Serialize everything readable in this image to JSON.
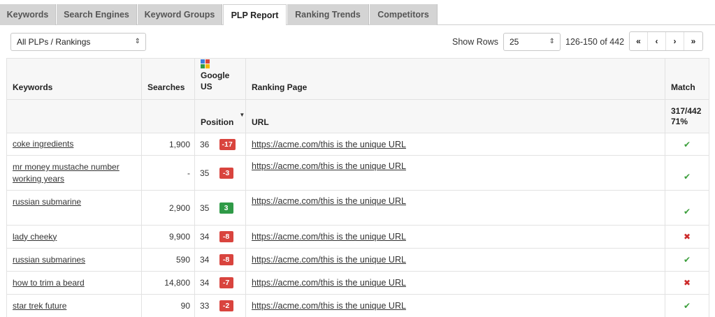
{
  "tabs": [
    {
      "label": "Keywords"
    },
    {
      "label": "Search Engines"
    },
    {
      "label": "Keyword Groups"
    },
    {
      "label": "PLP Report"
    },
    {
      "label": "Ranking Trends"
    },
    {
      "label": "Competitors"
    }
  ],
  "filter": {
    "value": "All PLPs / Rankings",
    "arrow": "⇕"
  },
  "pagination": {
    "show_rows_label": "Show Rows",
    "rows_value": "25",
    "range": "126-150 of 442",
    "first": "«",
    "prev": "‹",
    "next": "›",
    "last": "»"
  },
  "columns": {
    "keywords": "Keywords",
    "searches": "Searches",
    "engine": "Google",
    "engine_region": "US",
    "ranking_page": "Ranking Page",
    "match": "Match",
    "position": "Position",
    "url": "URL",
    "match_count": "317/442",
    "match_pct": "71%"
  },
  "colors": {
    "down": "#d9443e",
    "up": "#2f9a47",
    "check": "#3a9e3a",
    "cross": "#cc2a2a"
  },
  "rows": [
    {
      "keyword": "coke ingredients",
      "searches": "1,900",
      "position": "36",
      "change": "-17",
      "dir": "down",
      "url": "https://acme.com/this is the unique URL",
      "match": "✔",
      "match_type": "check"
    },
    {
      "keyword": "mr money mustache number working years",
      "searches": "-",
      "position": "35",
      "change": "-3",
      "dir": "down",
      "url": "https://acme.com/this is the unique URL",
      "match": "✔",
      "match_type": "check"
    },
    {
      "keyword": "russian submarine",
      "searches": "2,900",
      "position": "35",
      "change": "3",
      "dir": "up",
      "url": "https://acme.com/this is the unique URL",
      "match": "✔",
      "match_type": "check"
    },
    {
      "keyword": "lady cheeky",
      "searches": "9,900",
      "position": "34",
      "change": "-8",
      "dir": "down",
      "url": "https://acme.com/this is the unique URL",
      "match": "✖",
      "match_type": "cross"
    },
    {
      "keyword": "russian submarines",
      "searches": "590",
      "position": "34",
      "change": "-8",
      "dir": "down",
      "url": "https://acme.com/this is the unique URL",
      "match": "✔",
      "match_type": "check"
    },
    {
      "keyword": "how to trim a beard",
      "searches": "14,800",
      "position": "34",
      "change": "-7",
      "dir": "down",
      "url": "https://acme.com/this is the unique URL",
      "match": "✖",
      "match_type": "cross"
    },
    {
      "keyword": "star trek future",
      "searches": "90",
      "position": "33",
      "change": "-2",
      "dir": "down",
      "url": "https://acme.com/this is the unique URL",
      "match": "✔",
      "match_type": "check"
    }
  ]
}
